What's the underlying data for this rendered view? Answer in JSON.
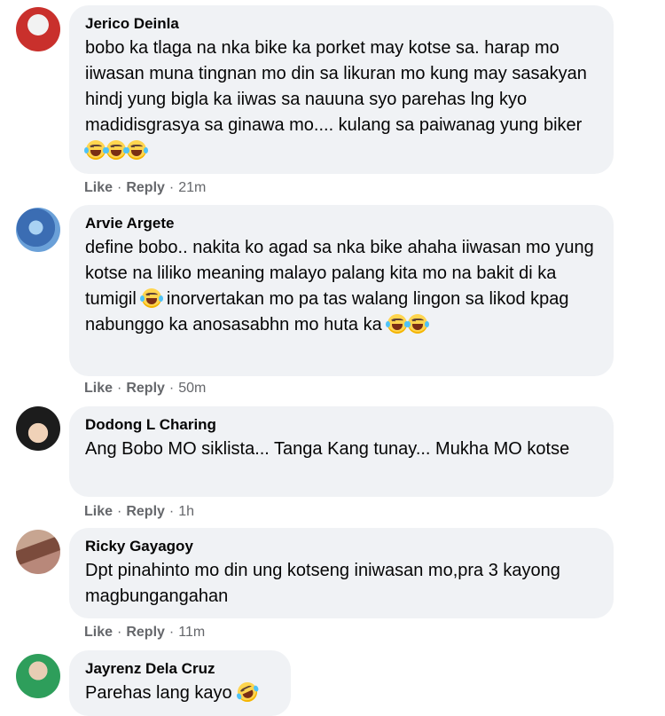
{
  "comments": [
    {
      "author": "Jerico Deinla",
      "text": "bobo ka tlaga na nka bike ka porket may kotse sa. harap mo iiwasan muna tingnan mo din sa likuran mo kung may sasakyan hindj yung bigla ka iiwas sa nauuna syo parehas lng kyo madidisgrasya sa ginawa mo.... kulang sa paiwanag yung biker",
      "like": "Like",
      "reply": "Reply",
      "time": "21m",
      "avatar_colors": [
        "#d9534f",
        "#f5f5f5"
      ]
    },
    {
      "author": "Arvie Argete",
      "text_a": "define bobo.. nakita ko agad sa nka bike ahaha iiwasan mo yung kotse na liliko meaning malayo palang kita mo na bakit di ka tumigil",
      "text_b": "inorvertakan mo pa tas walang lingon sa likod kpag nabunggo ka anosasabhn mo huta ka",
      "like": "Like",
      "reply": "Reply",
      "time": "50m",
      "avatar_colors": [
        "#3f6fb5",
        "#9fc3e9"
      ]
    },
    {
      "author": "Dodong L Charing",
      "text": "Ang Bobo MO siklista... Tanga Kang tunay... Mukha MO kotse",
      "like": "Like",
      "reply": "Reply",
      "time": "1h",
      "avatar_colors": [
        "#2b2b2b",
        "#e6c3a5"
      ]
    },
    {
      "author": "Ricky Gayagoy",
      "text": "Dpt pinahinto mo din ung kotseng iniwasan mo,pra 3 kayong magbungangahan",
      "like": "Like",
      "reply": "Reply",
      "time": "11m",
      "avatar_colors": [
        "#8d5a4a",
        "#c9a08b"
      ]
    },
    {
      "author": "Jayrenz Dela Cruz",
      "text": "Parehas lang kayo",
      "avatar_colors": [
        "#2e9e5b",
        "#e8d6c4"
      ]
    }
  ],
  "separator": "·",
  "icons": {
    "laugh": "face-with-tears-of-joy-icon",
    "rofl": "rolling-on-the-floor-laughing-icon"
  }
}
